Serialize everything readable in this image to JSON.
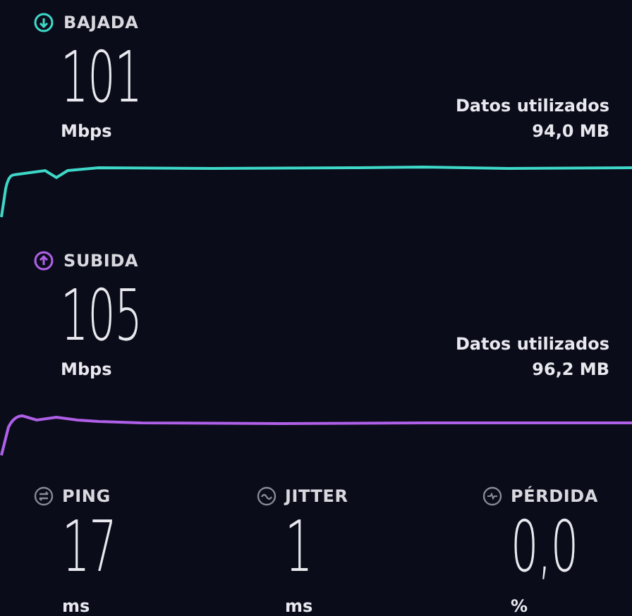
{
  "speeds": [
    {
      "kind": "download",
      "label": "BAJADA",
      "value": "101",
      "unit": "Mbps",
      "data_label": "Datos utilizados",
      "data_value": "94,0 MB",
      "color": "#3ed8c8"
    },
    {
      "kind": "upload",
      "label": "SUBIDA",
      "value": "105",
      "unit": "Mbps",
      "data_label": "Datos utilizados",
      "data_value": "96,2 MB",
      "color": "#b060e8"
    }
  ],
  "metrics": [
    {
      "kind": "ping",
      "label": "PING",
      "value": "17",
      "unit": "ms"
    },
    {
      "kind": "jitter",
      "label": "JITTER",
      "value": "1",
      "unit": "ms"
    },
    {
      "kind": "loss",
      "label": "PÉRDIDA",
      "value": "0,0",
      "unit": "%"
    }
  ]
}
